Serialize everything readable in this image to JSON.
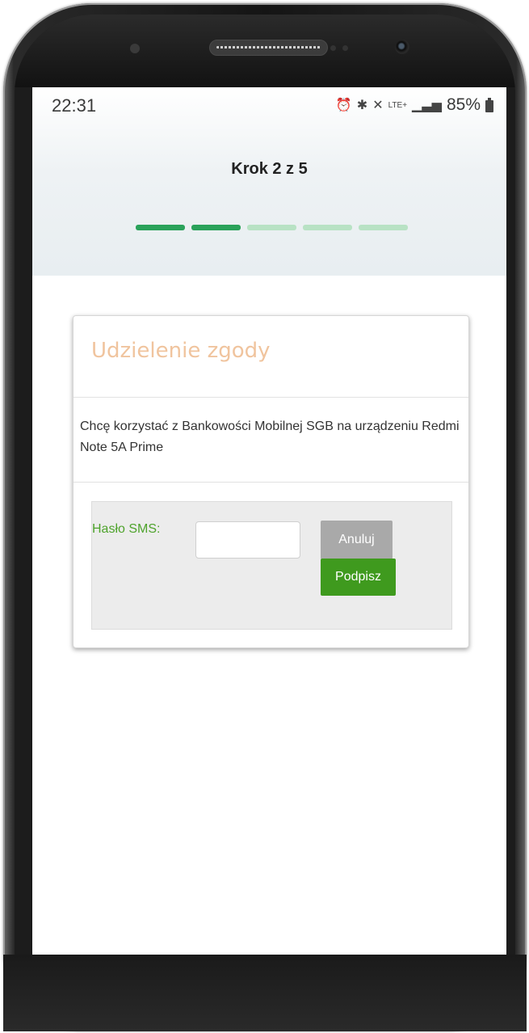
{
  "status_bar": {
    "time": "22:31",
    "icons": [
      "alarm-icon",
      "bluetooth-icon",
      "wifi-icon",
      "lte-icon",
      "signal-icon"
    ],
    "lte_label": "LTE+",
    "battery": "85%"
  },
  "wizard": {
    "step_label": "Krok 2 z 5",
    "current_step": 2,
    "total_steps": 5
  },
  "consent": {
    "title": "Udzielenie zgody",
    "message": "Chcę korzystać z Bankowości Mobilnej SGB na urządzeniu Redmi Note 5A Prime",
    "sms_label": "Hasło SMS:",
    "sms_value": "",
    "cancel_label": "Anuluj",
    "sign_label": "Podpisz"
  },
  "colors": {
    "progress_done": "#2aa25a",
    "progress_todo": "#b8e2c4",
    "title_accent": "#f0c49e",
    "label_green": "#4ea32c",
    "sign_button": "#3f9a1e",
    "cancel_button": "#a9a9a9"
  }
}
